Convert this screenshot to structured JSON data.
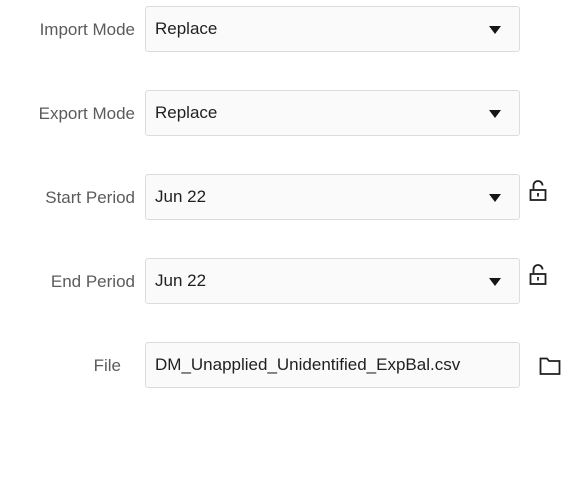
{
  "fields": {
    "import_mode": {
      "label": "Import Mode",
      "value": "Replace",
      "icon": "chevron-down-icon"
    },
    "export_mode": {
      "label": "Export Mode",
      "value": "Replace",
      "icon": "chevron-down-icon"
    },
    "start_period": {
      "label": "Start Period",
      "value": "Jun 22",
      "icon": "chevron-down-icon",
      "side_icon": "unlocked-icon"
    },
    "end_period": {
      "label": "End Period",
      "value": "Jun 22",
      "icon": "chevron-down-icon",
      "side_icon": "unlocked-icon"
    },
    "file": {
      "label": "File",
      "value": "DM_Unapplied_Unidentified_ExpBal.csv",
      "side_icon": "folder-icon"
    }
  }
}
